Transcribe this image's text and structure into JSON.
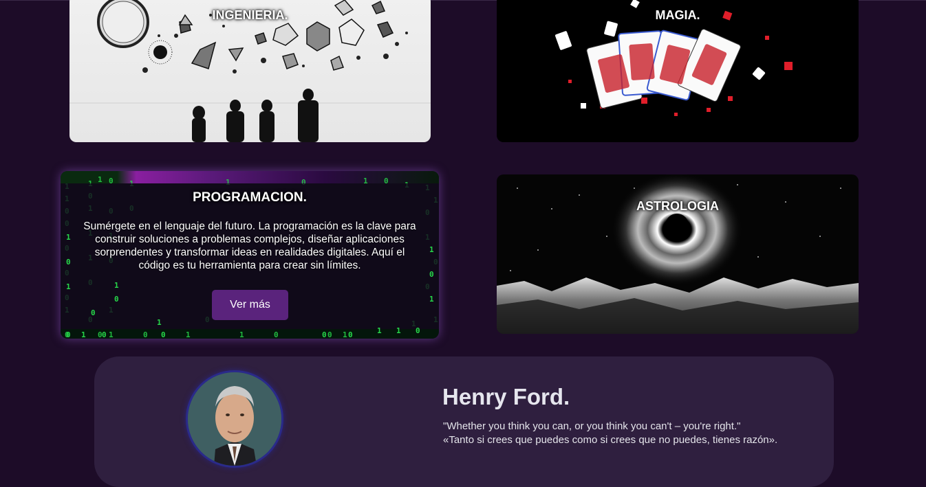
{
  "cards": {
    "ingenieria": {
      "title": "INGENIERIA."
    },
    "magia": {
      "title": "MAGIA."
    },
    "programacion": {
      "title": "PROGRAMACION.",
      "description": "Sumérgete en el lenguaje del futuro. La programación es la clave para construir soluciones a problemas complejos, diseñar aplicaciones sorprendentes y transformar ideas en realidades digitales. Aquí el código es tu herramienta para crear sin límites.",
      "button_label": "Ver más"
    },
    "astrologia": {
      "title": "ASTROLOGIA"
    }
  },
  "quote": {
    "author": "Henry Ford.",
    "text_en": "\"Whether you think you can, or you think you can't – you're right.\"",
    "text_es": "«Tanto si crees que puedes como si crees que no puedes, tienes razón»."
  },
  "colors": {
    "background": "#1d0c28",
    "quote_panel": "#2f1f3f",
    "button": "#5a237c",
    "matrix_green": "#27d84a"
  }
}
